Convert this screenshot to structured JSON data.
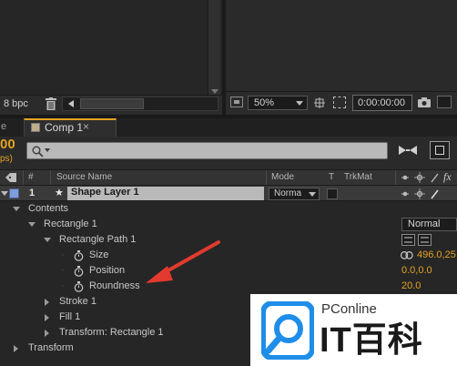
{
  "top": {
    "bpc_label": "8 bpc",
    "zoom_value": "50%",
    "timecode": "0:00:00:00"
  },
  "tabs": {
    "left_fragment": "e",
    "comp_tab_label": "Comp 1",
    "time_fragment": "00",
    "fps_fragment": "ps)"
  },
  "search": {
    "placeholder": "⌕˅"
  },
  "columns": {
    "hash": "#",
    "source_name": "Source Name",
    "mode": "Mode",
    "t": "T",
    "trkmat": "TrkMat",
    "fx": "fx"
  },
  "layer": {
    "number": "1",
    "name": "Shape Layer 1",
    "mode": "Norma"
  },
  "tree": {
    "contents": "Contents",
    "rectangle": "Rectangle 1",
    "rectangle_mode": "Normal",
    "rect_path": "Rectangle Path 1",
    "size": "Size",
    "size_value": "496.0,25",
    "position": "Position",
    "position_value": "0.0,0.0",
    "roundness": "Roundness",
    "roundness_value": "20.0",
    "stroke": "Stroke 1",
    "fill": "Fill 1",
    "transform_rect": "Transform: Rectangle 1",
    "transform": "Transform"
  },
  "watermark": {
    "brand_top": "PConline",
    "brand_bottom": "IT百科"
  },
  "colors": {
    "accent_orange": "#e4a223",
    "label_blue": "#7d9ddc",
    "arrow_red": "#e23a2e",
    "watermark_blue": "#1e8ee8"
  }
}
